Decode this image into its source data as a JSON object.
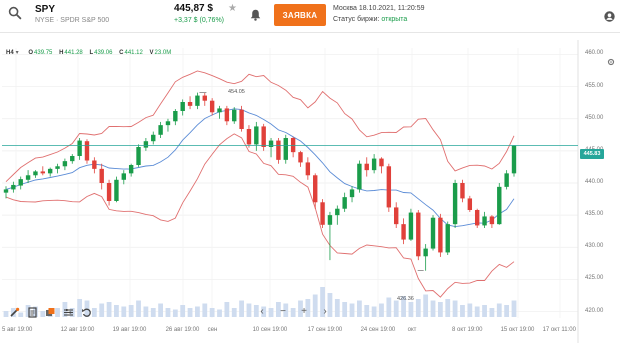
{
  "header": {
    "ticker": "SPY",
    "exchange_name": "NYSE · SPDR S&P 500",
    "price": "445,87 $",
    "change": "+3,37 $ (0,76%)",
    "order_button": "ЗАЯВКА",
    "server_time": "Москва 18.10.2021, 11:20:59",
    "exchange_status_label": "Статус биржи: ",
    "exchange_status_value": "открыта",
    "icons": {
      "search": "search-icon",
      "favorite": "star-icon",
      "alerts": "bell-icon",
      "profile": "user-icon"
    }
  },
  "toolbar": {
    "timeframe": "H4",
    "open_label": "O",
    "open": "439.75",
    "high_label": "H",
    "high": "441.28",
    "low_label": "L",
    "low": "439.06",
    "close_label": "C",
    "close": "441.12",
    "volume_label": "V",
    "volume": "23.0M"
  },
  "current_price_label": "445.83",
  "annotations": {
    "high_marker": "454.05",
    "low_marker": "426.36"
  },
  "colors": {
    "up": "#1a9c4a",
    "down": "#e0403a",
    "band": "#e07070",
    "ma": "#5b8cd6",
    "volume": "#cfdcef",
    "price_line": "#26a69a",
    "accent": "#f0711a"
  },
  "bottom_tools": [
    "brush-icon",
    "document-icon",
    "layers-icon",
    "indicators-icon",
    "undo-icon"
  ],
  "nav_controls": [
    "‹",
    "−",
    "+",
    "›"
  ],
  "chart_data": {
    "type": "candlestick",
    "y_ticks": [
      "460.00",
      "455.00",
      "450.00",
      "445.00",
      "440.00",
      "435.00",
      "430.00",
      "425.00",
      "420.00"
    ],
    "ylim": [
      419,
      461
    ],
    "x_tick_labels": [
      "5 авг 19:00",
      "12 авг 19:00",
      "19 авг 19:00",
      "26 авг 19:00",
      "сен",
      "10 сен 19:00",
      "17 сен 19:00",
      "24 сен 19:00",
      "окт",
      "8 окт 19:00",
      "15 окт 19:00",
      "17 окт 11:00"
    ],
    "candles": [
      [
        438.5,
        439.5,
        437.6,
        439.0
      ],
      [
        439.0,
        440.2,
        438.5,
        439.7
      ],
      [
        439.6,
        441.0,
        439.0,
        440.6
      ],
      [
        440.5,
        442.0,
        440.0,
        441.2
      ],
      [
        441.2,
        442.0,
        440.8,
        441.8
      ],
      [
        441.8,
        442.6,
        441.2,
        441.5
      ],
      [
        441.5,
        442.4,
        441.0,
        442.2
      ],
      [
        442.2,
        443.0,
        441.5,
        442.6
      ],
      [
        442.6,
        443.8,
        442.0,
        443.4
      ],
      [
        443.4,
        444.5,
        443.0,
        444.2
      ],
      [
        444.2,
        447.0,
        443.6,
        446.6
      ],
      [
        446.5,
        446.8,
        443.0,
        443.5
      ],
      [
        443.5,
        444.0,
        441.5,
        442.2
      ],
      [
        442.2,
        443.0,
        439.0,
        440.0
      ],
      [
        440.0,
        440.5,
        436.5,
        437.2
      ],
      [
        437.2,
        441.0,
        437.0,
        440.5
      ],
      [
        440.5,
        442.0,
        439.8,
        441.5
      ],
      [
        441.5,
        443.0,
        441.0,
        442.8
      ],
      [
        442.8,
        446.0,
        442.5,
        445.6
      ],
      [
        445.5,
        447.0,
        445.0,
        446.5
      ],
      [
        446.5,
        448.0,
        446.0,
        447.5
      ],
      [
        447.5,
        449.5,
        447.0,
        449.0
      ],
      [
        449.0,
        450.0,
        448.0,
        449.6
      ],
      [
        449.6,
        451.5,
        449.0,
        451.2
      ],
      [
        451.2,
        453.0,
        450.5,
        452.6
      ],
      [
        452.6,
        453.5,
        451.5,
        452.0
      ],
      [
        452.0,
        454.05,
        451.5,
        453.6
      ],
      [
        453.6,
        454.0,
        452.0,
        452.8
      ],
      [
        452.8,
        453.2,
        450.5,
        451.0
      ],
      [
        451.0,
        452.0,
        450.0,
        451.6
      ],
      [
        451.6,
        452.0,
        449.0,
        449.6
      ],
      [
        449.6,
        451.8,
        449.2,
        451.4
      ],
      [
        451.4,
        452.0,
        448.0,
        448.4
      ],
      [
        448.4,
        449.0,
        445.5,
        446.0
      ],
      [
        446.0,
        449.5,
        445.0,
        448.8
      ],
      [
        448.8,
        449.2,
        445.0,
        445.6
      ],
      [
        445.6,
        447.0,
        444.0,
        446.6
      ],
      [
        446.6,
        447.0,
        443.0,
        443.6
      ],
      [
        443.6,
        447.5,
        443.0,
        447.0
      ],
      [
        447.0,
        447.2,
        444.0,
        444.8
      ],
      [
        444.8,
        445.0,
        442.5,
        443.2
      ],
      [
        443.2,
        444.0,
        440.5,
        441.2
      ],
      [
        441.2,
        441.5,
        436.0,
        437.0
      ],
      [
        437.0,
        437.5,
        433.0,
        433.5
      ],
      [
        433.5,
        435.5,
        428.0,
        435.0
      ],
      [
        435.0,
        436.5,
        433.5,
        436.0
      ],
      [
        436.0,
        438.5,
        435.5,
        437.8
      ],
      [
        437.8,
        439.5,
        437.0,
        439.0
      ],
      [
        439.0,
        443.5,
        438.5,
        443.0
      ],
      [
        443.0,
        444.0,
        441.0,
        442.0
      ],
      [
        442.0,
        444.5,
        441.5,
        443.8
      ],
      [
        443.8,
        444.0,
        441.5,
        442.6
      ],
      [
        442.6,
        443.0,
        435.5,
        436.2
      ],
      [
        436.2,
        437.0,
        433.0,
        433.6
      ],
      [
        433.6,
        434.5,
        430.5,
        431.2
      ],
      [
        431.2,
        436.0,
        431.0,
        435.4
      ],
      [
        435.4,
        435.8,
        428.0,
        428.6
      ],
      [
        428.6,
        430.5,
        426.36,
        429.8
      ],
      [
        429.8,
        435.0,
        429.5,
        434.6
      ],
      [
        434.6,
        435.2,
        428.5,
        429.2
      ],
      [
        429.2,
        434.0,
        428.8,
        433.6
      ],
      [
        433.6,
        440.5,
        433.0,
        440.0
      ],
      [
        440.0,
        440.5,
        437.0,
        437.6
      ],
      [
        437.6,
        438.0,
        435.5,
        435.8
      ],
      [
        435.8,
        436.0,
        433.0,
        433.4
      ],
      [
        433.4,
        435.5,
        433.0,
        434.8
      ],
      [
        434.8,
        435.0,
        433.0,
        433.6
      ],
      [
        433.6,
        440.0,
        433.5,
        439.4
      ],
      [
        439.4,
        442.0,
        439.0,
        441.5
      ],
      [
        441.5,
        445.9,
        441.0,
        445.83
      ]
    ],
    "volume_relative": [
      0.2,
      0.3,
      0.15,
      0.4,
      0.35,
      0.2,
      0.25,
      0.3,
      0.5,
      0.3,
      0.6,
      0.55,
      0.3,
      0.45,
      0.5,
      0.4,
      0.35,
      0.4,
      0.55,
      0.35,
      0.3,
      0.45,
      0.3,
      0.25,
      0.4,
      0.3,
      0.35,
      0.45,
      0.3,
      0.25,
      0.5,
      0.3,
      0.55,
      0.45,
      0.4,
      0.35,
      0.3,
      0.5,
      0.45,
      0.3,
      0.55,
      0.6,
      0.75,
      1.0,
      0.8,
      0.6,
      0.5,
      0.45,
      0.55,
      0.4,
      0.35,
      0.45,
      0.65,
      0.55,
      0.7,
      0.5,
      0.6,
      0.75,
      0.55,
      0.5,
      0.6,
      0.55,
      0.4,
      0.45,
      0.35,
      0.4,
      0.3,
      0.45,
      0.4,
      0.55
    ],
    "grid": true
  }
}
